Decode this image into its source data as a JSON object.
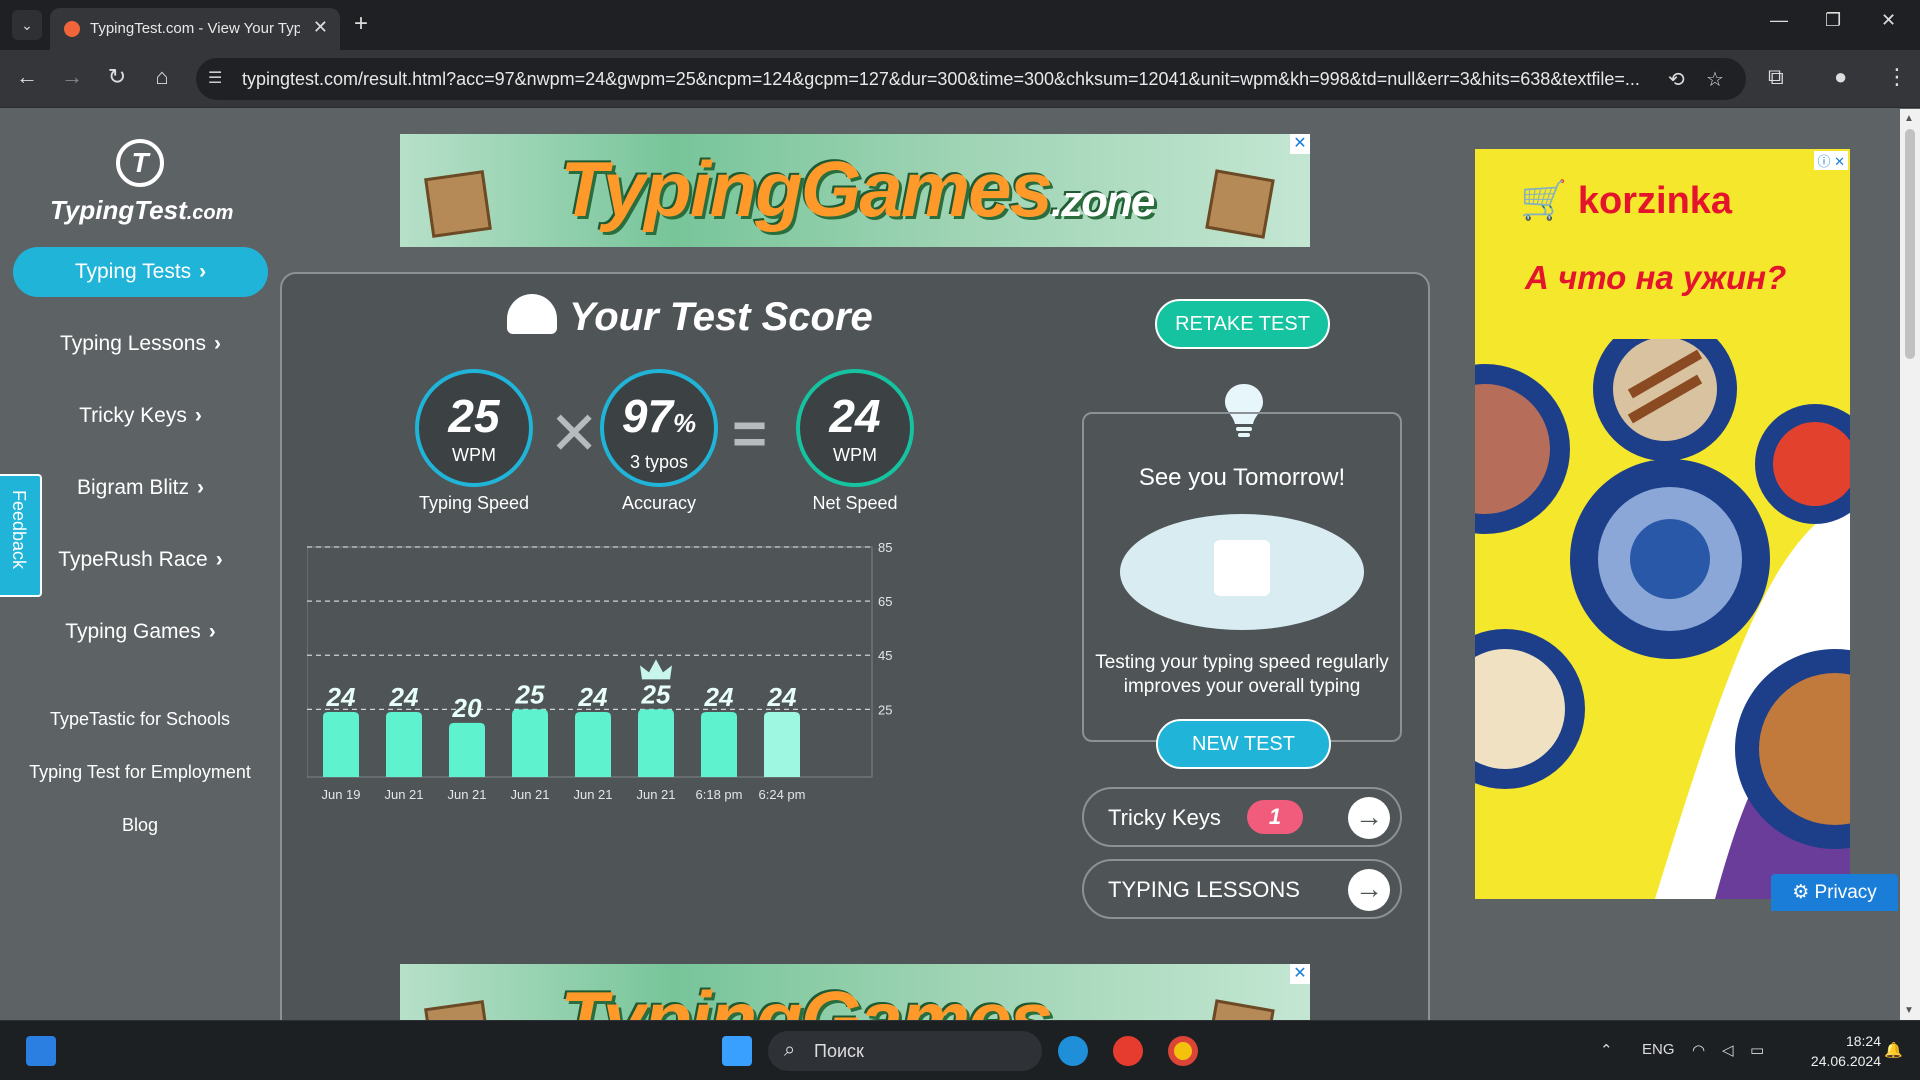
{
  "browser": {
    "tab_title": "TypingTest.com - View Your Typ",
    "url": "typingtest.com/result.html?acc=97&nwpm=24&gwpm=25&ncpm=124&gcpm=127&dur=300&time=300&chksum=12041&unit=wpm&kh=998&td=null&err=3&hits=638&textfile=..."
  },
  "sidebar": {
    "logo_text": "TypingTest",
    "logo_suffix": ".com",
    "logo_glyph": "T",
    "items": [
      {
        "label": "Typing Tests"
      },
      {
        "label": "Typing Lessons"
      },
      {
        "label": "Tricky Keys"
      },
      {
        "label": "Bigram Blitz"
      },
      {
        "label": "TypeRush Race"
      },
      {
        "label": "Typing Games"
      }
    ],
    "links": [
      "TypeTastic for Schools",
      "Typing Test for Employment",
      "Blog"
    ],
    "feedback": "Feedback"
  },
  "banner": {
    "text": "TypingGames",
    "suffix": ".zone"
  },
  "score": {
    "title": "Your Test Score",
    "retake": "RETAKE TEST",
    "typing_speed": {
      "value": "25",
      "unit": "WPM",
      "label": "Typing Speed"
    },
    "accuracy": {
      "value": "97",
      "unit": "%",
      "sub": "3 typos",
      "label": "Accuracy"
    },
    "net_speed": {
      "value": "24",
      "unit": "WPM",
      "label": "Net Speed"
    }
  },
  "chart_data": {
    "type": "bar",
    "categories": [
      "Jun 19",
      "Jun 21",
      "Jun 21",
      "Jun 21",
      "Jun 21",
      "Jun 21",
      "6:18 pm",
      "6:24 pm"
    ],
    "values": [
      24,
      24,
      20,
      25,
      24,
      25,
      24,
      24
    ],
    "y_ticks": [
      85,
      65,
      45,
      25
    ],
    "ylim": [
      0,
      85
    ],
    "best_index": 5,
    "bar_color": "#5ef2cf",
    "grid": "dashed"
  },
  "tomorrow": {
    "title": "See you Tomorrow!",
    "text_line1": "Testing your typing speed regularly",
    "text_line2": "improves your overall typing",
    "new_test": "NEW TEST"
  },
  "tricky_keys": {
    "label": "Tricky Keys",
    "count": "1"
  },
  "typing_lessons": {
    "label": "TYPING LESSONS"
  },
  "ad": {
    "brand": "korzinka",
    "tagline": "А что на ужин?"
  },
  "privacy": "Privacy",
  "taskbar": {
    "search_placeholder": "Поиск",
    "lang": "ENG",
    "time": "18:24",
    "date": "24.06.2024"
  }
}
